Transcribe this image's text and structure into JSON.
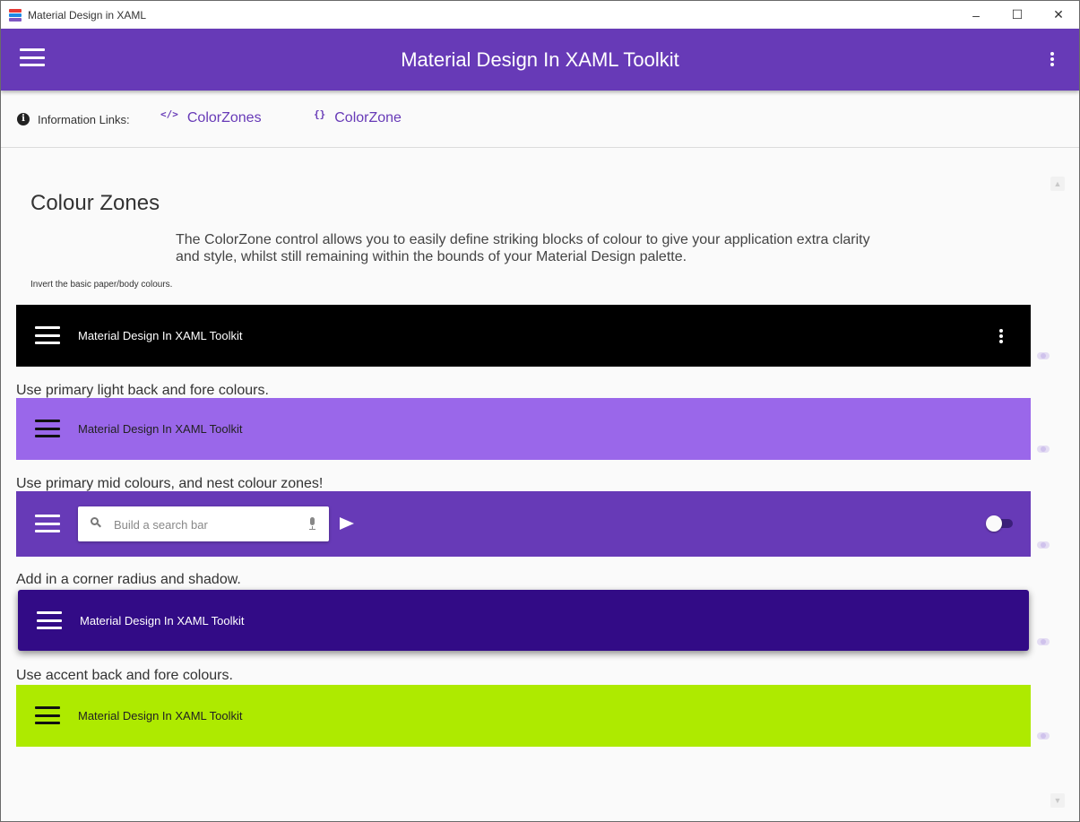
{
  "window": {
    "title": "Material Design in XAML",
    "controls": {
      "minimize": "–",
      "maximize": "☐",
      "close": "✕"
    }
  },
  "appbar": {
    "title": "Material Design In XAML Toolkit",
    "menu_icon": "hamburger-icon",
    "more_icon": "more-vert-icon",
    "color": "#673ab7"
  },
  "info": {
    "label": "Information Links:",
    "links": [
      {
        "icon": "</>",
        "label": "ColorZones"
      },
      {
        "icon": "{}",
        "label": "ColorZone"
      }
    ]
  },
  "page": {
    "heading": "Colour Zones",
    "description": "The ColorZone control allows you to easily define striking blocks of colour to give your application extra clarity and style, whilst still remaining within the bounds of your Material Design palette.",
    "invert_caption": "Invert the basic paper/body colours."
  },
  "zones": {
    "dark": {
      "title": "Material Design In XAML Toolkit",
      "color": "#000000"
    },
    "primary_light": {
      "caption": "Use primary light back and fore colours.",
      "title": "Material Design In XAML Toolkit",
      "color": "#9a67ea"
    },
    "primary_mid": {
      "caption": "Use primary mid colours, and nest colour zones!",
      "search_placeholder": "Build a search bar",
      "toggle_on": false,
      "color": "#673ab7"
    },
    "primary_dark": {
      "caption": "Add in a corner radius and shadow.",
      "title": "Material Design In XAML Toolkit",
      "color": "#320b86"
    },
    "accent": {
      "caption": "Use accent back and fore colours.",
      "title": "Material Design In XAML Toolkit",
      "color": "#aeea00"
    }
  }
}
